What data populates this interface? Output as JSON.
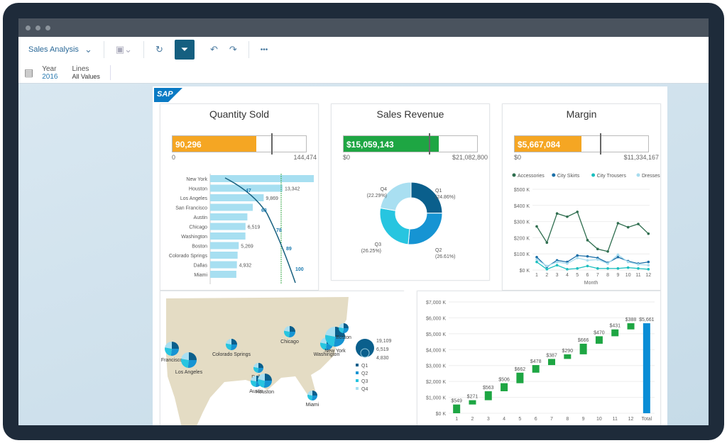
{
  "toolbar": {
    "story_title": "Sales Analysis",
    "icons": [
      "chevron-down-icon",
      "save-icon",
      "refresh-icon",
      "filter-icon",
      "undo-icon",
      "redo-icon",
      "more-icon"
    ],
    "more": "•••"
  },
  "filters": [
    {
      "label": "Year",
      "value": "2016"
    },
    {
      "label": "Lines",
      "value": "All Values"
    }
  ],
  "logo": "SAP",
  "colors": {
    "orange": "#f5a623",
    "green": "#1ea643",
    "blue": "#0a8dd6",
    "q1": "#0a5f8c",
    "q2": "#1694d3",
    "q3": "#27c5e0",
    "q4": "#a9dff1"
  },
  "kpis": [
    {
      "title": "Quantity Sold",
      "value": "90,296",
      "min": "0",
      "max": "144,474",
      "fraction": 0.625,
      "target": 0.74,
      "color": "#f5a623"
    },
    {
      "title": "Sales Revenue",
      "value": "$15,059,143",
      "min": "$0",
      "max": "$21,082,800",
      "fraction": 0.714,
      "target": 0.64,
      "color": "#1ea643"
    },
    {
      "title": "Margin",
      "value": "$5,667,084",
      "min": "$0",
      "max": "$11,334,167",
      "fraction": 0.5,
      "target": 0.64,
      "color": "#f5a623"
    }
  ],
  "chart_data": [
    {
      "type": "bar",
      "orientation": "horizontal",
      "categories": [
        "New York",
        "Houston",
        "Los Angeles",
        "San Francisco",
        "Austin",
        "Chicago",
        "Washington",
        "Boston",
        "Colorado Springs",
        "Dallas",
        "Miami"
      ],
      "values": [
        19109,
        13342,
        9869,
        7860,
        6860,
        6519,
        6500,
        5269,
        5060,
        4932,
        4830
      ],
      "labels": [
        "",
        "13,342",
        "9,869",
        "",
        "",
        "6,519",
        "",
        "5,269",
        "",
        "4,932",
        ""
      ],
      "pareto": {
        "points": [
          {
            "at": "Houston",
            "label": "47"
          },
          {
            "at": "San Francisco",
            "label": "63"
          },
          {
            "at": "Washington",
            "label": "78"
          },
          {
            "at": "Colorado Springs",
            "label": "89"
          },
          {
            "at": "Miami",
            "label": "100"
          }
        ]
      }
    },
    {
      "type": "pie",
      "donut": true,
      "slices": [
        {
          "label": "Q1",
          "pct": "(24.86%)",
          "value": 24.86
        },
        {
          "label": "Q2",
          "pct": "(26.61%)",
          "value": 26.61
        },
        {
          "label": "Q3",
          "pct": "(26.25%)",
          "value": 26.25
        },
        {
          "label": "Q4",
          "pct": "(22.29%)",
          "value": 22.29
        }
      ]
    },
    {
      "type": "line",
      "xlabel": "Month",
      "x": [
        1,
        2,
        3,
        4,
        5,
        6,
        7,
        8,
        9,
        10,
        11,
        12
      ],
      "yticks": [
        "$0 K",
        "$100 K",
        "$200 K",
        "$300 K",
        "$400 K",
        "$500 K"
      ],
      "ylim": [
        0,
        500
      ],
      "legend": [
        "Accessories",
        "City Skirts",
        "City Trousers",
        "Dresses"
      ],
      "legend_more": "-",
      "series": [
        {
          "name": "Accessories",
          "color": "#2f6e4f",
          "values": [
            270,
            170,
            350,
            330,
            360,
            185,
            130,
            115,
            290,
            265,
            285,
            225
          ]
        },
        {
          "name": "City Skirts",
          "color": "#1b6fa8",
          "values": [
            80,
            20,
            60,
            50,
            90,
            85,
            75,
            45,
            80,
            55,
            40,
            50
          ]
        },
        {
          "name": "City Trousers",
          "color": "#1bbfbf",
          "values": [
            50,
            5,
            30,
            5,
            10,
            25,
            10,
            10,
            10,
            15,
            10,
            5
          ]
        },
        {
          "name": "Dresses",
          "color": "#a8dcef",
          "values": [
            65,
            25,
            50,
            40,
            75,
            60,
            65,
            40,
            95,
            50,
            35,
            30
          ]
        }
      ]
    },
    {
      "type": "bubble-map",
      "cities": [
        "Francisco",
        "Los Angeles",
        "Colorado Springs",
        "Chicago",
        "Washington",
        "New York",
        "Boston",
        "Dallas",
        "Austin",
        "Houston",
        "Miami"
      ],
      "size_legend": [
        "19,109",
        "6,519",
        "4,830"
      ],
      "legend": [
        "Q1",
        "Q2",
        "Q3",
        "Q4"
      ]
    },
    {
      "type": "bar",
      "subtype": "waterfall",
      "categories": [
        "1",
        "2",
        "3",
        "4",
        "5",
        "6",
        "7",
        "8",
        "9",
        "10",
        "11",
        "12",
        "Total"
      ],
      "values": [
        549,
        271,
        563,
        506,
        662,
        478,
        387,
        290,
        666,
        470,
        431,
        388,
        5661
      ],
      "labels": [
        "$549",
        "$271",
        "$563",
        "$506",
        "$662",
        "$478",
        "$387",
        "$290",
        "$666",
        "$470",
        "$431",
        "$388",
        "$5,661"
      ],
      "yticks": [
        "$0 K",
        "$1,000 K",
        "$2,000 K",
        "$3,000 K",
        "$4,000 K",
        "$5,000 K",
        "$6,000 K",
        "$7,000 K"
      ],
      "ylim": [
        0,
        7000
      ]
    }
  ]
}
